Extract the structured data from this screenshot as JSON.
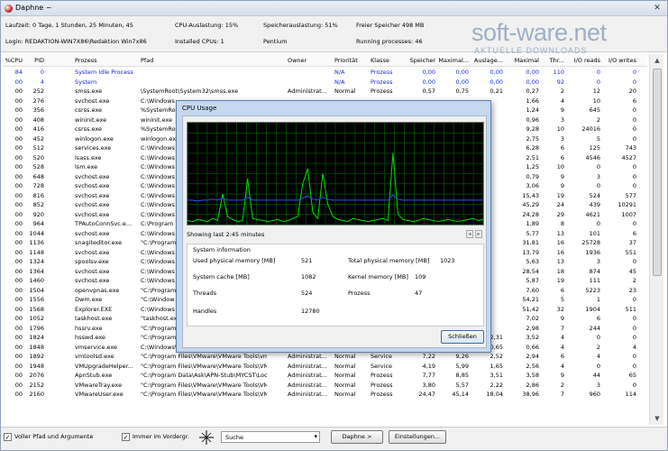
{
  "window": {
    "title": "Daphne ~",
    "close_glyph": "✕"
  },
  "info": {
    "uptime": "Laufzeit: 0 Tage, 1 Stunden, 25 Minuten, 45",
    "cpu_load": "CPU-Auslastung: 15%",
    "mem_load": "Speicherauslastung: 51%",
    "free_mem": "Freier Speicher 498 MB",
    "login": "Login: REDAKTION-WIN7X86\\Redaktion Win7x86",
    "cpus": "Installed CPUs: 1",
    "cpu_name": "Pentium",
    "procs": "Running processes: 46"
  },
  "logo": {
    "text": "soft-ware.net",
    "tagline": "AKTUELLE DOWNLOADS"
  },
  "columns": [
    "%CPU",
    "PID",
    "Prozess",
    "Pfad",
    "Owner",
    "Priorität",
    "Klasse",
    "Speicher",
    "Maximal...",
    "Auslage...",
    "Maximal",
    "Thr...",
    "I/O reads",
    "I/O writes"
  ],
  "rows": [
    [
      "84",
      "0",
      "System Idle Process",
      "",
      "",
      "N/A",
      "Prozess",
      "0,00",
      "0,00",
      "0,00",
      "0,00",
      "110",
      "0",
      "0"
    ],
    [
      "00",
      "4",
      "System",
      "",
      "",
      "N/A",
      "Prozess",
      "0,00",
      "0,00",
      "0,00",
      "0,00",
      "92",
      "0",
      "0"
    ],
    [
      "00",
      "252",
      "smss.exe",
      "\\SystemRoot\\System32\\smss.exe",
      "Administrat...",
      "Normal",
      "Prozess",
      "0,57",
      "0,75",
      "0,21",
      "0,27",
      "2",
      "12",
      "20"
    ],
    [
      "00",
      "276",
      "svchost.exe",
      "C:\\Windows",
      "",
      "",
      "",
      "",
      "",
      "",
      "1,66",
      "4",
      "10",
      "6"
    ],
    [
      "00",
      "356",
      "csrss.exe",
      "%SystemRo",
      "",
      "",
      "",
      "",
      "",
      "",
      "1,24",
      "9",
      "645",
      "0"
    ],
    [
      "00",
      "408",
      "wininit.exe",
      "wininit.exe",
      "",
      "",
      "",
      "",
      "",
      "",
      "0,96",
      "3",
      "2",
      "0"
    ],
    [
      "00",
      "416",
      "csrss.exe",
      "%SystemRo",
      "",
      "",
      "",
      "",
      "",
      "",
      "9,28",
      "10",
      "24016",
      "0"
    ],
    [
      "00",
      "452",
      "winlogon.exe",
      "winlogon.exe",
      "",
      "",
      "",
      "",
      "",
      "",
      "2,75",
      "3",
      "5",
      "0"
    ],
    [
      "00",
      "512",
      "services.exe",
      "C:\\Windows",
      "",
      "",
      "",
      "",
      "",
      "",
      "6,28",
      "6",
      "125",
      "743"
    ],
    [
      "00",
      "520",
      "lsass.exe",
      "C:\\Windows",
      "",
      "",
      "",
      "",
      "",
      "",
      "2,51",
      "6",
      "4546",
      "4527"
    ],
    [
      "00",
      "528",
      "lsm.exe",
      "C:\\Windows",
      "",
      "",
      "",
      "",
      "",
      "",
      "1,25",
      "10",
      "0",
      "0"
    ],
    [
      "00",
      "648",
      "svchost.exe",
      "C:\\Windows",
      "",
      "",
      "",
      "",
      "",
      "",
      "0,79",
      "9",
      "3",
      "0"
    ],
    [
      "00",
      "728",
      "svchost.exe",
      "C:\\Windows",
      "",
      "",
      "",
      "",
      "",
      "",
      "3,06",
      "9",
      "0",
      "0"
    ],
    [
      "00",
      "816",
      "svchost.exe",
      "C:\\Windows",
      "",
      "",
      "",
      "",
      "",
      "",
      "15,43",
      "19",
      "524",
      "577"
    ],
    [
      "00",
      "852",
      "svchost.exe",
      "C:\\Windows",
      "",
      "",
      "",
      "",
      "",
      "",
      "45,29",
      "24",
      "439",
      "10291"
    ],
    [
      "00",
      "920",
      "svchost.exe",
      "C:\\Windows",
      "",
      "",
      "",
      "",
      "",
      "",
      "24,28",
      "29",
      "4621",
      "1007"
    ],
    [
      "00",
      "964",
      "TPAutoConnSvc.e...",
      "C:\\Program",
      "",
      "",
      "",
      "",
      "",
      "",
      "1,89",
      "8",
      "0",
      "0"
    ],
    [
      "00",
      "1044",
      "svchost.exe",
      "C:\\Windows",
      "",
      "",
      "",
      "",
      "",
      "",
      "5,77",
      "13",
      "101",
      "6"
    ],
    [
      "00",
      "1136",
      "snagiteditor.exe",
      "\"C:\\Program",
      "",
      "",
      "",
      "",
      "",
      "",
      "31,81",
      "16",
      "25728",
      "37"
    ],
    [
      "00",
      "1148",
      "svchost.exe",
      "C:\\Windows",
      "",
      "",
      "",
      "",
      "",
      "",
      "13,79",
      "16",
      "1936",
      "551"
    ],
    [
      "00",
      "1324",
      "spoolsv.exe",
      "C:\\Windows",
      "",
      "",
      "",
      "",
      "",
      "",
      "5,63",
      "13",
      "3",
      "0"
    ],
    [
      "00",
      "1364",
      "svchost.exe",
      "C:\\Windows",
      "",
      "",
      "",
      "",
      "",
      "",
      "28,54",
      "18",
      "874",
      "45"
    ],
    [
      "00",
      "1460",
      "svchost.exe",
      "C:\\Windows",
      "",
      "",
      "",
      "",
      "",
      "",
      "5,87",
      "19",
      "111",
      "2"
    ],
    [
      "00",
      "1504",
      "openvpnas.exe",
      "\"C:\\Program",
      "",
      "",
      "",
      "",
      "",
      "",
      "7,60",
      "6",
      "5223",
      "23"
    ],
    [
      "00",
      "1556",
      "Dwm.exe",
      "\"C:\\Window",
      "",
      "",
      "",
      "",
      "",
      "",
      "54,21",
      "5",
      "1",
      "0"
    ],
    [
      "00",
      "1568",
      "Explorer.EXE",
      "C:\\Windows",
      "",
      "",
      "",
      "",
      "",
      "",
      "51,42",
      "32",
      "1904",
      "511"
    ],
    [
      "00",
      "1052",
      "taskhost.exe",
      "\"taskhost.exe",
      "",
      "",
      "",
      "",
      "",
      "",
      "7,02",
      "9",
      "6",
      "0"
    ],
    [
      "00",
      "1796",
      "hssrv.exe",
      "\"C:\\Program",
      "",
      "",
      "",
      "",
      "",
      "",
      "2,98",
      "7",
      "244",
      "0"
    ],
    [
      "00",
      "1824",
      "hsswd.exe",
      "\"C:\\Program Files\\Hotspot Shield\\bin\\hsswd.exe\"",
      "Administrat...",
      "Normal",
      "Service",
      "3,56",
      "4,50",
      "2,31",
      "3,52",
      "4",
      "0",
      "0"
    ],
    [
      "00",
      "1848",
      "vmservice.exe",
      "C:\\Windows\\vmservice.exe",
      "Administrat...",
      "Normal",
      "Service",
      "1,86",
      "2,30",
      "0,65",
      "0,66",
      "4",
      "2",
      "4"
    ],
    [
      "00",
      "1892",
      "vmtoolsd.exe",
      "\"C:\\Program Files\\VMware\\VMware Tools\\vmtool...",
      "Administrat...",
      "Normal",
      "Service",
      "7,22",
      "9,26",
      "2,52",
      "2,94",
      "6",
      "4",
      "0"
    ],
    [
      "00",
      "1948",
      "VMUpgradeHelper...",
      "\"C:\\Program Files\\VMware\\VMware Tools\\VMU...",
      "Administrat...",
      "Normal",
      "Service",
      "4,19",
      "5,99",
      "1,65",
      "2,56",
      "4",
      "0",
      "0"
    ],
    [
      "00",
      "2076",
      "ApnStub.exe",
      "\"C:\\Program Data\\Ask\\APN-Stub\\MYCST\\Loc...",
      "Administrat...",
      "Normal",
      "Prozess",
      "7,77",
      "8,85",
      "3,51",
      "3,58",
      "9",
      "44",
      "65"
    ],
    [
      "00",
      "2152",
      "VMwareTray.exe",
      "\"C:\\Program Files\\VMware\\VMware Tools\\VMw...",
      "Administrat...",
      "Normal",
      "Prozess",
      "3,80",
      "5,57",
      "2,22",
      "2,86",
      "2",
      "3",
      "0"
    ],
    [
      "00",
      "2160",
      "VMwareUser.exe",
      "\"C:\\Program Files\\VMware\\VMware Tools\\VMw...",
      "Administrat...",
      "Normal",
      "Prozess",
      "24,47",
      "45,14",
      "18,04",
      "38,96",
      "7",
      "960",
      "114"
    ]
  ],
  "bottom": {
    "full_path_label": "Voller Pfad und Argumente",
    "foreground_label": "Immer im Vordergr.",
    "search_value": "Suche",
    "daphne_button": "Daphne >",
    "settings_button": "Einstellungen..."
  },
  "dialog": {
    "title": "CPU Usage",
    "showing": "Showing last 2:45 minutes",
    "group_title": "System information",
    "used_phys_label": "Used physical memory [MB]",
    "used_phys": "521",
    "total_phys_label": "Total physical memory [MB]",
    "total_phys": "1023",
    "sys_cache_label": "System cache [MB]",
    "sys_cache": "1082",
    "kernel_mem_label": "Kernel memory [MB]",
    "kernel_mem": "109",
    "threads_label": "Threads",
    "threads": "524",
    "processes_label": "Prozess",
    "processes": "47",
    "handles_label": "Handles",
    "handles": "12780",
    "close_button": "Schließen"
  },
  "chart_data": {
    "type": "line",
    "series_colors": [
      "#00e000",
      "#3050ff"
    ],
    "grid": true,
    "series": [
      {
        "values": [
          4,
          3,
          5,
          4,
          3,
          6,
          4,
          30,
          8,
          5,
          3,
          4,
          45,
          6,
          5,
          4,
          3,
          4,
          5,
          3,
          4,
          6,
          8,
          40,
          55,
          12,
          6,
          50,
          20,
          8,
          5,
          4,
          3,
          6,
          5,
          4,
          3,
          4,
          5,
          6,
          4,
          70,
          10,
          5,
          4,
          3,
          4,
          6,
          5,
          4,
          3,
          4,
          5,
          4,
          3,
          4,
          5,
          6,
          4,
          5
        ]
      },
      {
        "values": [
          24,
          24,
          23,
          24,
          24,
          25,
          24,
          26,
          24,
          24,
          24,
          24,
          27,
          24,
          24,
          24,
          24,
          24,
          24,
          24,
          24,
          24,
          24,
          26,
          28,
          25,
          24,
          27,
          25,
          24,
          24,
          24,
          24,
          24,
          24,
          24,
          24,
          24,
          24,
          24,
          24,
          29,
          25,
          24,
          24,
          24,
          24,
          24,
          24,
          24,
          24,
          24,
          24,
          24,
          24,
          24,
          24,
          24,
          24,
          24
        ]
      }
    ]
  }
}
